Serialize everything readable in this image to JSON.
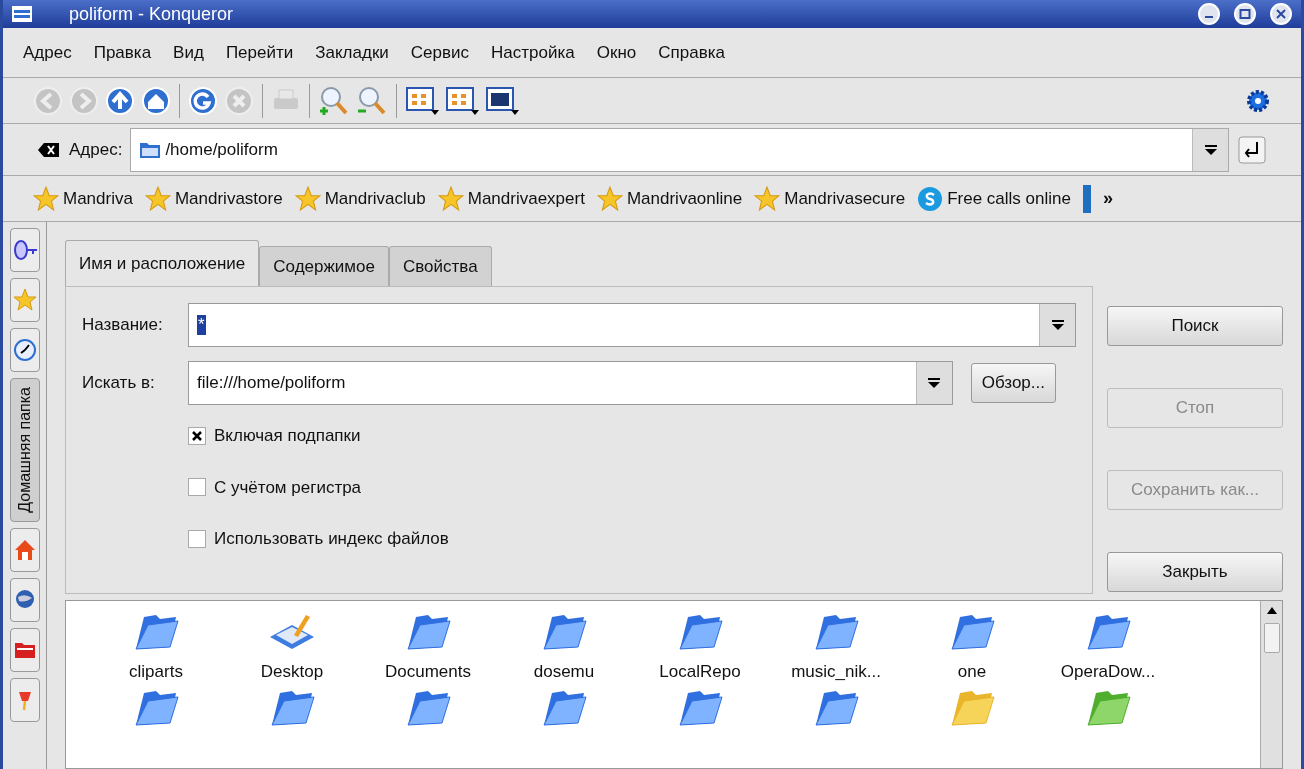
{
  "window": {
    "title": "poliform - Konqueror"
  },
  "menu": [
    "Адрес",
    "Правка",
    "Вид",
    "Перейти",
    "Закладки",
    "Сервис",
    "Настройка",
    "Окно",
    "Справка"
  ],
  "toolbar": [
    {
      "kind": "back",
      "disabled": true
    },
    {
      "kind": "forward",
      "disabled": true
    },
    {
      "kind": "up",
      "disabled": false
    },
    {
      "kind": "home",
      "disabled": false
    },
    {
      "kind": "sep"
    },
    {
      "kind": "reload",
      "disabled": false
    },
    {
      "kind": "stop",
      "disabled": true
    },
    {
      "kind": "sep"
    },
    {
      "kind": "print",
      "disabled": true
    },
    {
      "kind": "sep"
    },
    {
      "kind": "zoom_in",
      "disabled": false
    },
    {
      "kind": "zoom_out",
      "disabled": false
    },
    {
      "kind": "sep"
    },
    {
      "kind": "view_icons",
      "disabled": false
    },
    {
      "kind": "view_tree",
      "disabled": false
    },
    {
      "kind": "view_image",
      "disabled": false
    }
  ],
  "location": {
    "label": "Адрес:",
    "value": "/home/poliform"
  },
  "bookmarks": [
    {
      "kind": "star",
      "label": "Mandriva"
    },
    {
      "kind": "star",
      "label": "Mandrivastore"
    },
    {
      "kind": "star",
      "label": "Mandrivaclub"
    },
    {
      "kind": "star",
      "label": "Mandrivaexpert"
    },
    {
      "kind": "star",
      "label": "Mandrivaonline"
    },
    {
      "kind": "star",
      "label": "Mandrivasecure"
    },
    {
      "kind": "skype",
      "label": "Free calls online"
    }
  ],
  "bookmarks_more": "»",
  "sidebar": [
    {
      "kind": "key",
      "selected": false
    },
    {
      "kind": "star",
      "selected": false
    },
    {
      "kind": "history",
      "selected": false
    },
    {
      "kind": "text",
      "label": "Домашняя папка",
      "selected": true
    },
    {
      "kind": "home",
      "selected": false
    },
    {
      "kind": "network",
      "selected": false
    },
    {
      "kind": "folder",
      "selected": false
    },
    {
      "kind": "pin",
      "selected": false
    }
  ],
  "find": {
    "tabs": [
      {
        "label": "Имя и расположение",
        "selected": true
      },
      {
        "label": "Содержимое",
        "selected": false
      },
      {
        "label": "Свойства",
        "selected": false
      }
    ],
    "name_label": "Название:",
    "name_value": "*",
    "look_in_label": "Искать в:",
    "look_in_value": "file:///home/poliform",
    "browse": "Обзор...",
    "options": [
      {
        "label": "Включая подпапки",
        "checked": true
      },
      {
        "label": "С учётом регистра",
        "checked": false
      },
      {
        "label": "Использовать индекс файлов",
        "checked": false
      }
    ],
    "buttons": [
      {
        "label": "Поиск",
        "disabled": false
      },
      {
        "label": "Стоп",
        "disabled": true
      },
      {
        "label": "Сохранить как...",
        "disabled": true
      },
      {
        "label": "Закрыть",
        "disabled": false
      }
    ]
  },
  "files": [
    {
      "kind": "folder",
      "name": "cliparts"
    },
    {
      "kind": "desktop",
      "name": "Desktop"
    },
    {
      "kind": "folder",
      "name": "Documents"
    },
    {
      "kind": "folder",
      "name": "dosemu"
    },
    {
      "kind": "folder",
      "name": "LocalRepo"
    },
    {
      "kind": "folder",
      "name": "music_nik..."
    },
    {
      "kind": "folder",
      "name": "one"
    },
    {
      "kind": "folder",
      "name": "OperaDow..."
    },
    {
      "kind": "folder"
    },
    {
      "kind": "folder"
    },
    {
      "kind": "folder"
    },
    {
      "kind": "folder"
    },
    {
      "kind": "folder"
    },
    {
      "kind": "folder"
    },
    {
      "kind": "folder_yellow"
    },
    {
      "kind": "folder_green"
    }
  ]
}
